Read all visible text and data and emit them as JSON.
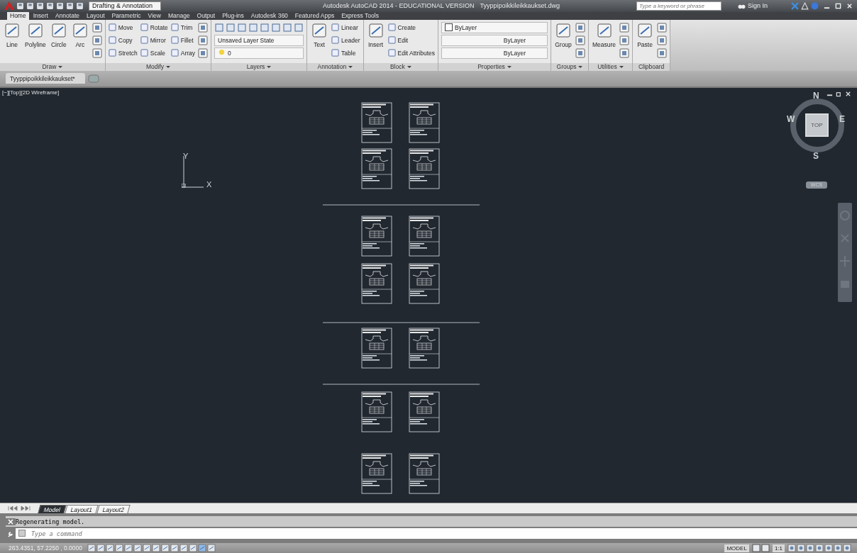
{
  "title_bar": {
    "workspace": "Drafting & Annotation",
    "title": "Autodesk AutoCAD 2014 - EDUCATIONAL VERSION",
    "file": "Tyyppipoikkileikkaukset.dwg",
    "search": {
      "placeholder": "Type a keyword or phrase"
    },
    "sign_in": "Sign In"
  },
  "ribbon_tabs": [
    {
      "label": "Home",
      "selected": true
    },
    {
      "label": "Insert",
      "selected": false
    },
    {
      "label": "Annotate",
      "selected": false
    },
    {
      "label": "Layout",
      "selected": false
    },
    {
      "label": "Parametric",
      "selected": false
    },
    {
      "label": "View",
      "selected": false
    },
    {
      "label": "Manage",
      "selected": false
    },
    {
      "label": "Output",
      "selected": false
    },
    {
      "label": "Plug-ins",
      "selected": false
    },
    {
      "label": "Autodesk 360",
      "selected": false
    },
    {
      "label": "Featured Apps",
      "selected": false
    },
    {
      "label": "Express Tools",
      "selected": false
    }
  ],
  "panels": [
    {
      "title": "Draw",
      "dropdown": true,
      "columns": [
        [
          {
            "kind": "large",
            "label": "Line"
          }
        ],
        [
          {
            "kind": "large",
            "label": "Polyline"
          }
        ],
        [
          {
            "kind": "large",
            "label": "Circle"
          }
        ],
        [
          {
            "kind": "large",
            "label": "Arc"
          }
        ],
        [
          {
            "kind": "icon"
          },
          {
            "kind": "icon"
          },
          {
            "kind": "icon"
          }
        ]
      ]
    },
    {
      "title": "Modify",
      "dropdown": true,
      "columns": [
        [
          {
            "kind": "small",
            "label": "Move"
          },
          {
            "kind": "small",
            "label": "Copy"
          },
          {
            "kind": "small",
            "label": "Stretch"
          }
        ],
        [
          {
            "kind": "small",
            "label": "Rotate"
          },
          {
            "kind": "small",
            "label": "Mirror"
          },
          {
            "kind": "small",
            "label": "Scale"
          }
        ],
        [
          {
            "kind": "small",
            "label": "Trim"
          },
          {
            "kind": "small",
            "label": "Fillet"
          },
          {
            "kind": "small",
            "label": "Array"
          }
        ],
        [
          {
            "kind": "icon"
          },
          {
            "kind": "icon"
          },
          {
            "kind": "icon"
          }
        ]
      ]
    },
    {
      "title": "Layers",
      "dropdown": true,
      "columns": [
        [
          {
            "kind": "iconrow"
          },
          {
            "kind": "combo",
            "label": "Unsaved Layer State"
          },
          {
            "kind": "layer",
            "label": "0"
          }
        ]
      ]
    },
    {
      "title": "Annotation",
      "dropdown": true,
      "columns": [
        [
          {
            "kind": "large",
            "label": "Text"
          }
        ],
        [
          {
            "kind": "small",
            "label": "Linear"
          },
          {
            "kind": "small",
            "label": "Leader"
          },
          {
            "kind": "small",
            "label": "Table"
          }
        ]
      ]
    },
    {
      "title": "Block",
      "dropdown": true,
      "columns": [
        [
          {
            "kind": "large",
            "label": "Insert"
          }
        ],
        [
          {
            "kind": "small",
            "label": "Create"
          },
          {
            "kind": "small",
            "label": "Edit"
          },
          {
            "kind": "small",
            "label": "Edit Attributes"
          }
        ]
      ]
    },
    {
      "title": "Properties",
      "dropdown": true,
      "columns": [
        [
          {
            "kind": "color",
            "label": "ByLayer"
          },
          {
            "kind": "line",
            "label": "ByLayer"
          },
          {
            "kind": "line",
            "label": "ByLayer"
          }
        ]
      ]
    },
    {
      "title": "Groups",
      "dropdown": true,
      "columns": [
        [
          {
            "kind": "large",
            "label": "Group"
          }
        ],
        [
          {
            "kind": "icon"
          },
          {
            "kind": "icon"
          },
          {
            "kind": "icon"
          }
        ]
      ]
    },
    {
      "title": "Utilities",
      "dropdown": true,
      "columns": [
        [
          {
            "kind": "large",
            "label": "Measure"
          }
        ],
        [
          {
            "kind": "icon"
          },
          {
            "kind": "icon"
          },
          {
            "kind": "icon"
          }
        ]
      ]
    },
    {
      "title": "Clipboard",
      "dropdown": false,
      "columns": [
        [
          {
            "kind": "large",
            "label": "Paste"
          }
        ],
        [
          {
            "kind": "icon"
          },
          {
            "kind": "icon"
          },
          {
            "kind": "icon"
          }
        ]
      ]
    }
  ],
  "document_tab": "Tyyppipoikkileikkaukset*",
  "viewport": {
    "label": "[−][Top][2D Wireframe]",
    "ucs": {
      "x": "X",
      "y": "Y"
    },
    "viewcube": {
      "n": "N",
      "e": "E",
      "s": "S",
      "w": "W",
      "face": "TOP",
      "wcs": "WCS"
    }
  },
  "layout_tabs": [
    {
      "label": "Model",
      "selected": true
    },
    {
      "label": "Layout1",
      "selected": false
    },
    {
      "label": "Layout2",
      "selected": false
    }
  ],
  "command_line": {
    "history": "Regenerating model.",
    "placeholder": "Type a command"
  },
  "status_bar": {
    "coordinates": "263.4351, 57.2250 , 0.0000",
    "space": "MODEL",
    "scale": "1:1"
  }
}
